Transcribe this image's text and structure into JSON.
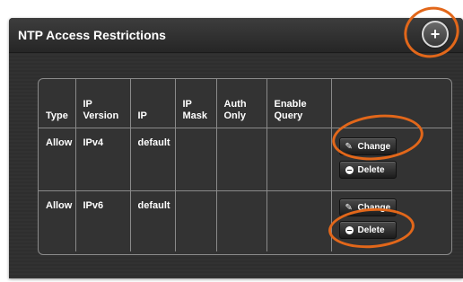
{
  "panel": {
    "title": "NTP Access Restrictions",
    "add_label": "+"
  },
  "table": {
    "headers": [
      [
        "",
        "Type"
      ],
      [
        "IP",
        "Version"
      ],
      [
        "",
        "IP"
      ],
      [
        "IP",
        "Mask"
      ],
      [
        "Auth",
        "Only"
      ],
      [
        "Enable",
        "Query"
      ],
      [
        "",
        ""
      ]
    ],
    "rows": [
      {
        "type": "Allow",
        "ip_version": "IPv4",
        "ip": "default",
        "ip_mask": "",
        "auth_only": "",
        "enable_query": ""
      },
      {
        "type": "Allow",
        "ip_version": "IPv6",
        "ip": "default",
        "ip_mask": "",
        "auth_only": "",
        "enable_query": ""
      }
    ],
    "actions": {
      "change_label": "Change",
      "delete_label": "Delete"
    }
  },
  "colors": {
    "highlight": "#e2671a",
    "panel_bg": "#2f2f2f",
    "header_bg": "#262626"
  },
  "icons": {
    "change": "pencil-icon",
    "delete": "minus-circle-icon",
    "add": "plus-icon"
  }
}
